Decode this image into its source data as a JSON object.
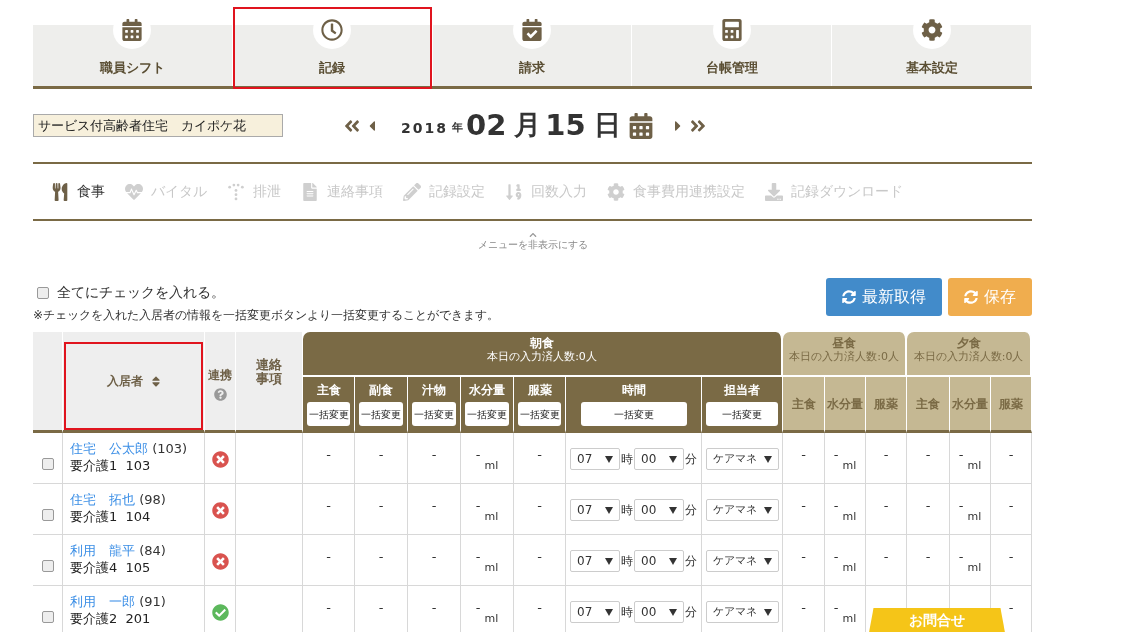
{
  "nav_tabs": [
    {
      "label": "職員シフト",
      "kind": "calendar",
      "highlighted": false
    },
    {
      "label": "記録",
      "kind": "clock",
      "highlighted": true
    },
    {
      "label": "請求",
      "kind": "calendar-check",
      "highlighted": false
    },
    {
      "label": "台帳管理",
      "kind": "calculator",
      "highlighted": false
    },
    {
      "label": "基本設定",
      "kind": "gear",
      "highlighted": false
    }
  ],
  "facility": "サービス付高齢者住宅　カイポケ花",
  "date": {
    "year": "2018",
    "year_unit": "年",
    "month": "02",
    "month_unit": "月",
    "day": "15",
    "day_unit": "日"
  },
  "record_menu": [
    {
      "label": "食事",
      "kind": "utensils",
      "active": true
    },
    {
      "label": "バイタル",
      "kind": "heartbeat",
      "active": false
    },
    {
      "label": "排泄",
      "kind": "dots",
      "active": false
    },
    {
      "label": "連絡事項",
      "kind": "document",
      "active": false
    },
    {
      "label": "記録設定",
      "kind": "pencil",
      "active": false
    },
    {
      "label": "回数入力",
      "kind": "count",
      "active": false
    },
    {
      "label": "食事費用連携設定",
      "kind": "gear",
      "active": false
    },
    {
      "label": "記録ダウンロード",
      "kind": "download",
      "active": false
    }
  ],
  "hide_menu": "メニューを非表示にする",
  "check_all": {
    "label": "全てにチェックを入れる。",
    "checked": false
  },
  "note": "※チェックを入れた入居者の情報を一括変更ボタンより一括変更することができます。",
  "buttons": [
    {
      "label": "最新取得",
      "kind": "refresh"
    },
    {
      "label": "保存",
      "kind": "save"
    }
  ],
  "table": {
    "resident_header": {
      "label": "入居者",
      "highlighted": true
    },
    "link_header": "連携",
    "notes_header": "連絡事項",
    "meals": [
      {
        "title": "朝食",
        "count": "本日の入力済人数:0人",
        "active": true,
        "columns": [
          {
            "label": "主食",
            "bulk": "一括変更"
          },
          {
            "label": "副食",
            "bulk": "一括変更"
          },
          {
            "label": "汁物",
            "bulk": "一括変更"
          },
          {
            "label": "水分量",
            "bulk": "一括変更"
          },
          {
            "label": "服薬",
            "bulk": "一括変更"
          },
          {
            "label": "時間",
            "bulk": "一括変更"
          },
          {
            "label": "担当者",
            "bulk": "一括変更"
          }
        ]
      },
      {
        "title": "昼食",
        "count": "本日の入力済人数:0人",
        "active": false,
        "columns": [
          {
            "label": "主食"
          },
          {
            "label": "水分量"
          },
          {
            "label": "服薬"
          }
        ]
      },
      {
        "title": "夕食",
        "count": "本日の入力済人数:0人",
        "active": false,
        "columns": [
          {
            "label": "主食"
          },
          {
            "label": "水分量"
          },
          {
            "label": "服薬"
          }
        ]
      }
    ],
    "rows": [
      {
        "checked": false,
        "name": "住宅　公太郎",
        "age": "(103)",
        "care": "要介護1  103",
        "linked": false,
        "breakfast": [
          {
            "kind": "text",
            "value": "-"
          },
          {
            "kind": "text",
            "value": "-"
          },
          {
            "kind": "text",
            "value": "-"
          },
          {
            "kind": "amount",
            "value": "-",
            "unit": "ml"
          },
          {
            "kind": "text",
            "value": "-"
          },
          {
            "kind": "time",
            "hour": "07",
            "hour_unit": "時",
            "minute": "00",
            "minute_unit": "分"
          },
          {
            "kind": "select",
            "value": "ケアマネ"
          }
        ],
        "lunch": {
          "staple": {
            "kind": "text",
            "value": "-"
          },
          "water": {
            "kind": "amount",
            "value": "-",
            "unit": "ml"
          },
          "medicine": {
            "kind": "text",
            "value": "-"
          }
        },
        "dinner": {
          "staple": {
            "kind": "text",
            "value": "-"
          },
          "water": {
            "kind": "amount",
            "value": "-",
            "unit": "ml"
          },
          "medicine": {
            "kind": "text",
            "value": "-"
          }
        }
      },
      {
        "checked": false,
        "name": "住宅　拓也",
        "age": "(98)",
        "care": "要介護1  104",
        "linked": false,
        "breakfast": [
          {
            "kind": "text",
            "value": "-"
          },
          {
            "kind": "text",
            "value": "-"
          },
          {
            "kind": "text",
            "value": "-"
          },
          {
            "kind": "amount",
            "value": "-",
            "unit": "ml"
          },
          {
            "kind": "text",
            "value": "-"
          },
          {
            "kind": "time",
            "hour": "07",
            "hour_unit": "時",
            "minute": "00",
            "minute_unit": "分"
          },
          {
            "kind": "select",
            "value": "ケアマネ"
          }
        ],
        "lunch": {
          "staple": {
            "kind": "text",
            "value": "-"
          },
          "water": {
            "kind": "amount",
            "value": "-",
            "unit": "ml"
          },
          "medicine": {
            "kind": "text",
            "value": "-"
          }
        },
        "dinner": {
          "staple": {
            "kind": "text",
            "value": "-"
          },
          "water": {
            "kind": "amount",
            "value": "-",
            "unit": "ml"
          },
          "medicine": {
            "kind": "text",
            "value": "-"
          }
        }
      },
      {
        "checked": false,
        "name": "利用　龍平",
        "age": "(84)",
        "care": "要介護4  105",
        "linked": false,
        "breakfast": [
          {
            "kind": "text",
            "value": "-"
          },
          {
            "kind": "text",
            "value": "-"
          },
          {
            "kind": "text",
            "value": "-"
          },
          {
            "kind": "amount",
            "value": "-",
            "unit": "ml"
          },
          {
            "kind": "text",
            "value": "-"
          },
          {
            "kind": "time",
            "hour": "07",
            "hour_unit": "時",
            "minute": "00",
            "minute_unit": "分"
          },
          {
            "kind": "select",
            "value": "ケアマネ"
          }
        ],
        "lunch": {
          "staple": {
            "kind": "text",
            "value": "-"
          },
          "water": {
            "kind": "amount",
            "value": "-",
            "unit": "ml"
          },
          "medicine": {
            "kind": "text",
            "value": "-"
          }
        },
        "dinner": {
          "staple": {
            "kind": "text",
            "value": "-"
          },
          "water": {
            "kind": "amount",
            "value": "-",
            "unit": "ml"
          },
          "medicine": {
            "kind": "text",
            "value": "-"
          }
        }
      },
      {
        "checked": false,
        "name": "利用　一郎",
        "age": "(91)",
        "care": "要介護2  201",
        "linked": true,
        "breakfast": [
          {
            "kind": "text",
            "value": "-"
          },
          {
            "kind": "text",
            "value": "-"
          },
          {
            "kind": "text",
            "value": "-"
          },
          {
            "kind": "amount",
            "value": "-",
            "unit": "ml"
          },
          {
            "kind": "text",
            "value": "-"
          },
          {
            "kind": "time",
            "hour": "07",
            "hour_unit": "時",
            "minute": "00",
            "minute_unit": "分"
          },
          {
            "kind": "select",
            "value": "ケアマネ"
          }
        ],
        "lunch": {
          "staple": {
            "kind": "text",
            "value": "-"
          },
          "water": {
            "kind": "amount",
            "value": "-",
            "unit": "ml"
          }
        },
        "dinner": {
          "medicine": {
            "kind": "text",
            "value": "-"
          }
        }
      }
    ]
  },
  "contact_tab": "お問合せ"
}
